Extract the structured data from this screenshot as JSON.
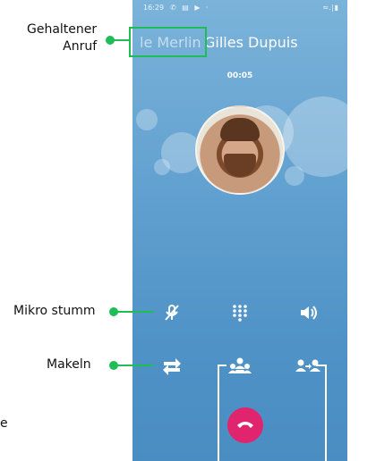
{
  "status_bar": {
    "time": "16:29"
  },
  "call": {
    "held_name": "le Merlin",
    "active_name": "Gilles Dupuis",
    "duration": "00:05"
  },
  "annotations": {
    "held_call": "Gehaltener\nAnruf",
    "mute": "Mikro stumm",
    "swap": "Makeln",
    "cut_letter": "e"
  },
  "icons": {
    "mute": "mic-off-icon",
    "keypad": "keypad-icon",
    "speaker": "speaker-icon",
    "swap": "swap-arrows-icon",
    "conference": "conference-icon",
    "transfer": "transfer-icon",
    "hangup": "hangup-icon"
  },
  "colors": {
    "annotation_green": "#1fbd55",
    "hangup_pink": "#e0256e",
    "screen_blue": "#5f9fcf"
  }
}
